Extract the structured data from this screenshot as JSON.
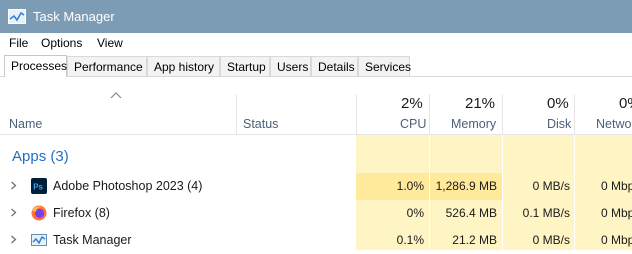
{
  "window": {
    "title": "Task Manager",
    "icon": "task-manager-icon"
  },
  "menu": {
    "items": [
      "File",
      "Options",
      "View"
    ]
  },
  "tabs": [
    "Processes",
    "Performance",
    "App history",
    "Startup",
    "Users",
    "Details",
    "Services"
  ],
  "active_tab": "Processes",
  "columns": {
    "name": "Name",
    "status": "Status",
    "cpu": {
      "label": "CPU",
      "percent": "2%"
    },
    "memory": {
      "label": "Memory",
      "percent": "21%"
    },
    "disk": {
      "label": "Disk",
      "percent": "0%"
    },
    "network": {
      "label": "Netwo",
      "percent": "0%"
    }
  },
  "group": {
    "title": "Apps (3)"
  },
  "processes": [
    {
      "name": "Adobe Photoshop 2023 (4)",
      "icon": "photoshop-icon",
      "cpu": "1.0%",
      "memory": "1,286.9 MB",
      "disk": "0 MB/s",
      "network": "0 Mbp"
    },
    {
      "name": "Firefox (8)",
      "icon": "firefox-icon",
      "cpu": "0%",
      "memory": "526.4 MB",
      "disk": "0.1 MB/s",
      "network": "0 Mbp"
    },
    {
      "name": "Task Manager",
      "icon": "task-manager-icon",
      "cpu": "0.1%",
      "memory": "21.2 MB",
      "disk": "0 MB/s",
      "network": "0 Mbp"
    }
  ],
  "colors": {
    "titlebar": "#7c9cb5",
    "heat_light": "#fff4c4",
    "heat_medium": "#ffe99a",
    "group_title": "#1f6fc5",
    "header_label": "#4c607a"
  }
}
